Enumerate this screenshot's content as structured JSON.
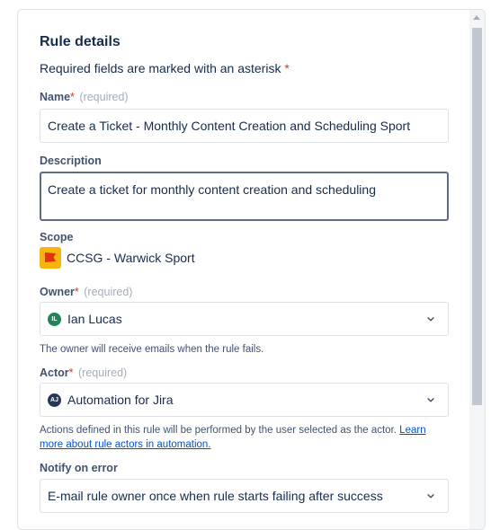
{
  "section": {
    "title": "Rule details",
    "required_note": "Required fields are marked with an asterisk",
    "asterisk": "*"
  },
  "name_field": {
    "label": "Name",
    "required": "(required)",
    "value": "Create a Ticket - Monthly Content Creation and Scheduling Sport"
  },
  "description_field": {
    "label": "Description",
    "value": "Create a ticket for monthly content creation and scheduling"
  },
  "scope": {
    "label": "Scope",
    "value": "CCSG - Warwick Sport",
    "icon": "flag-icon"
  },
  "owner": {
    "label": "Owner",
    "required": "(required)",
    "avatar_initials": "IL",
    "avatar_color": "#1f845a",
    "value": "Ian Lucas",
    "helper": "The owner will receive emails when the rule fails."
  },
  "actor": {
    "label": "Actor",
    "required": "(required)",
    "avatar_initials": "AJ",
    "avatar_color": "#253858",
    "value": "Automation for Jira",
    "helper_text": "Actions defined in this rule will be performed by the user selected as the actor.",
    "link_part1": "Learn",
    "link_part2": "more about rule actors in automation."
  },
  "notify": {
    "label": "Notify on error",
    "value": "E-mail rule owner once when rule starts failing after success"
  },
  "colors": {
    "accent_link": "#0052cc",
    "required_star": "#de350b",
    "text_primary": "#172b4d"
  }
}
